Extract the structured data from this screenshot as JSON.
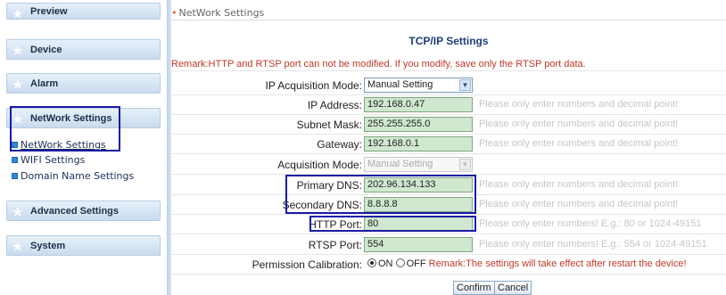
{
  "sidebar": {
    "preview": "Preview",
    "device": "Device",
    "alarm": "Alarm",
    "network": "NetWork Settings",
    "network_items": [
      "NetWork Settings",
      "WIFI Settings",
      "Domain Name Settings"
    ],
    "advanced": "Advanced Settings",
    "system": "System"
  },
  "breadcrumb": "NetWork Settings",
  "section_title": "TCP/IP Settings",
  "remark": "Remark:HTTP and RTSP port can not be modified. If you modify, save only the RTSP port data.",
  "form": {
    "ip_mode_label": "IP Acquisition Mode:",
    "ip_mode_value": "Manual Setting",
    "ip_label": "IP Address:",
    "ip_value": "192.168.0.47",
    "subnet_label": "Subnet Mask:",
    "subnet_value": "255.255.255.0",
    "gateway_label": "Gateway:",
    "gateway_value": "192.168.0.1",
    "acq_mode_label": "Acquisition Mode:",
    "acq_mode_value": "Manual Setting",
    "pdns_label": "Primary DNS:",
    "pdns_value": "202.96.134.133",
    "sdns_label": "Secondary DNS:",
    "sdns_value": "8.8.8.8",
    "http_label": "HTTP Port:",
    "http_value": "80",
    "rtsp_label": "RTSP Port:",
    "rtsp_value": "554",
    "perm_label": "Permission Calibration:",
    "perm_on": "ON",
    "perm_off": "OFF",
    "perm_remark": "Remark:The settings will take effect after restart the device!"
  },
  "hints": {
    "numbers_decimal": "Please only enter numbers and decimal point!",
    "http_hint": "Please only enter numbers! E.g.: 80 or 1024-49151",
    "rtsp_hint": "Please only enter numbers! E.g.: 554 or 1024-49151"
  },
  "buttons": {
    "confirm": "Confirm",
    "cancel": "Cancel"
  },
  "colors": {
    "remark_red": "#c0392b",
    "highlight_blue": "#1a1aa5",
    "field_green": "#cfe8cf",
    "title_blue": "#1f3d7a"
  }
}
